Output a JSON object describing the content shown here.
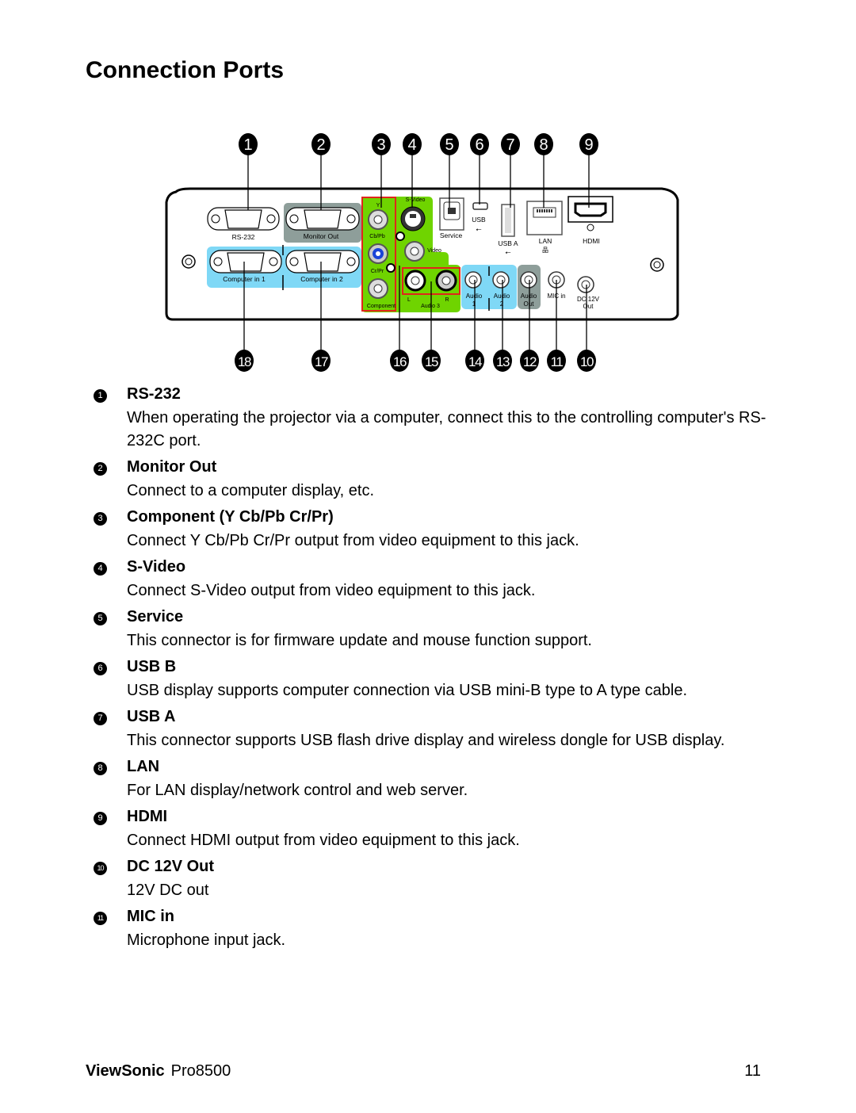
{
  "page": {
    "title": "Connection Ports",
    "footer": {
      "brand": "ViewSonic",
      "model": "Pro8500",
      "page_number": "11"
    }
  },
  "colors": {
    "panel_blue": "#7fd8f6",
    "panel_green": "#6fd400",
    "panel_gray": "#8e9e9a",
    "outline_red": "#e0261b",
    "pb_blue": "#1a44d8",
    "callout": "#000000"
  },
  "diagram": {
    "callouts_top": [
      "1",
      "2",
      "3",
      "4",
      "5",
      "6",
      "7",
      "8",
      "9"
    ],
    "callouts_bottom": [
      "18",
      "17",
      "16",
      "15",
      "14",
      "13",
      "12",
      "11",
      "10"
    ],
    "labels": {
      "rs232": "RS-232",
      "monitor_out": "Monitor Out",
      "computer_in_1": "Computer in 1",
      "computer_in_2": "Computer in 2",
      "y": "Y",
      "cb_pb": "Cb/Pb",
      "cr_pr": "Cr/Pr",
      "component": "Component",
      "s_video": "S-Video",
      "video": "Video",
      "service": "Service",
      "usb": "USB",
      "usb_a": "USB A",
      "lan": "LAN",
      "hdmi": "HDMI",
      "audio3_l": "L",
      "audio3_r": "R",
      "audio3": "Audio 3",
      "audio1": "Audio",
      "audio1_n": "1",
      "audio2": "Audio",
      "audio2_n": "2",
      "audio_out": "Audio",
      "audio_out_2": "Out",
      "mic_in": "MIC in",
      "dc12v": "DC 12V",
      "dc12v_2": "Out"
    }
  },
  "items": [
    {
      "number": "1",
      "title": "RS-232",
      "description": "When operating the projector via a computer, connect this to the controlling computer's RS-232C port."
    },
    {
      "number": "2",
      "title": "Monitor Out",
      "description": "Connect to a computer display, etc."
    },
    {
      "number": "3",
      "title": "Component (Y Cb/Pb Cr/Pr)",
      "description": "Connect Y Cb/Pb Cr/Pr output from video equipment to this jack."
    },
    {
      "number": "4",
      "title": "S-Video",
      "description": "Connect S-Video output from video equipment to this jack."
    },
    {
      "number": "5",
      "title": "Service",
      "description": "This connector is for firmware update and mouse function support."
    },
    {
      "number": "6",
      "title": "USB B",
      "description": "USB display supports computer connection via USB mini-B type to A type cable."
    },
    {
      "number": "7",
      "title": "USB A",
      "description": "This connector supports USB flash drive display and wireless dongle for USB display."
    },
    {
      "number": "8",
      "title": "LAN",
      "description": "For LAN display/network control and web server."
    },
    {
      "number": "9",
      "title": "HDMI",
      "description": "Connect HDMI output from video equipment to this jack."
    },
    {
      "number": "10",
      "title": "DC 12V Out",
      "description": "12V DC out"
    },
    {
      "number": "11",
      "title": "MIC in",
      "description": "Microphone input jack."
    }
  ]
}
